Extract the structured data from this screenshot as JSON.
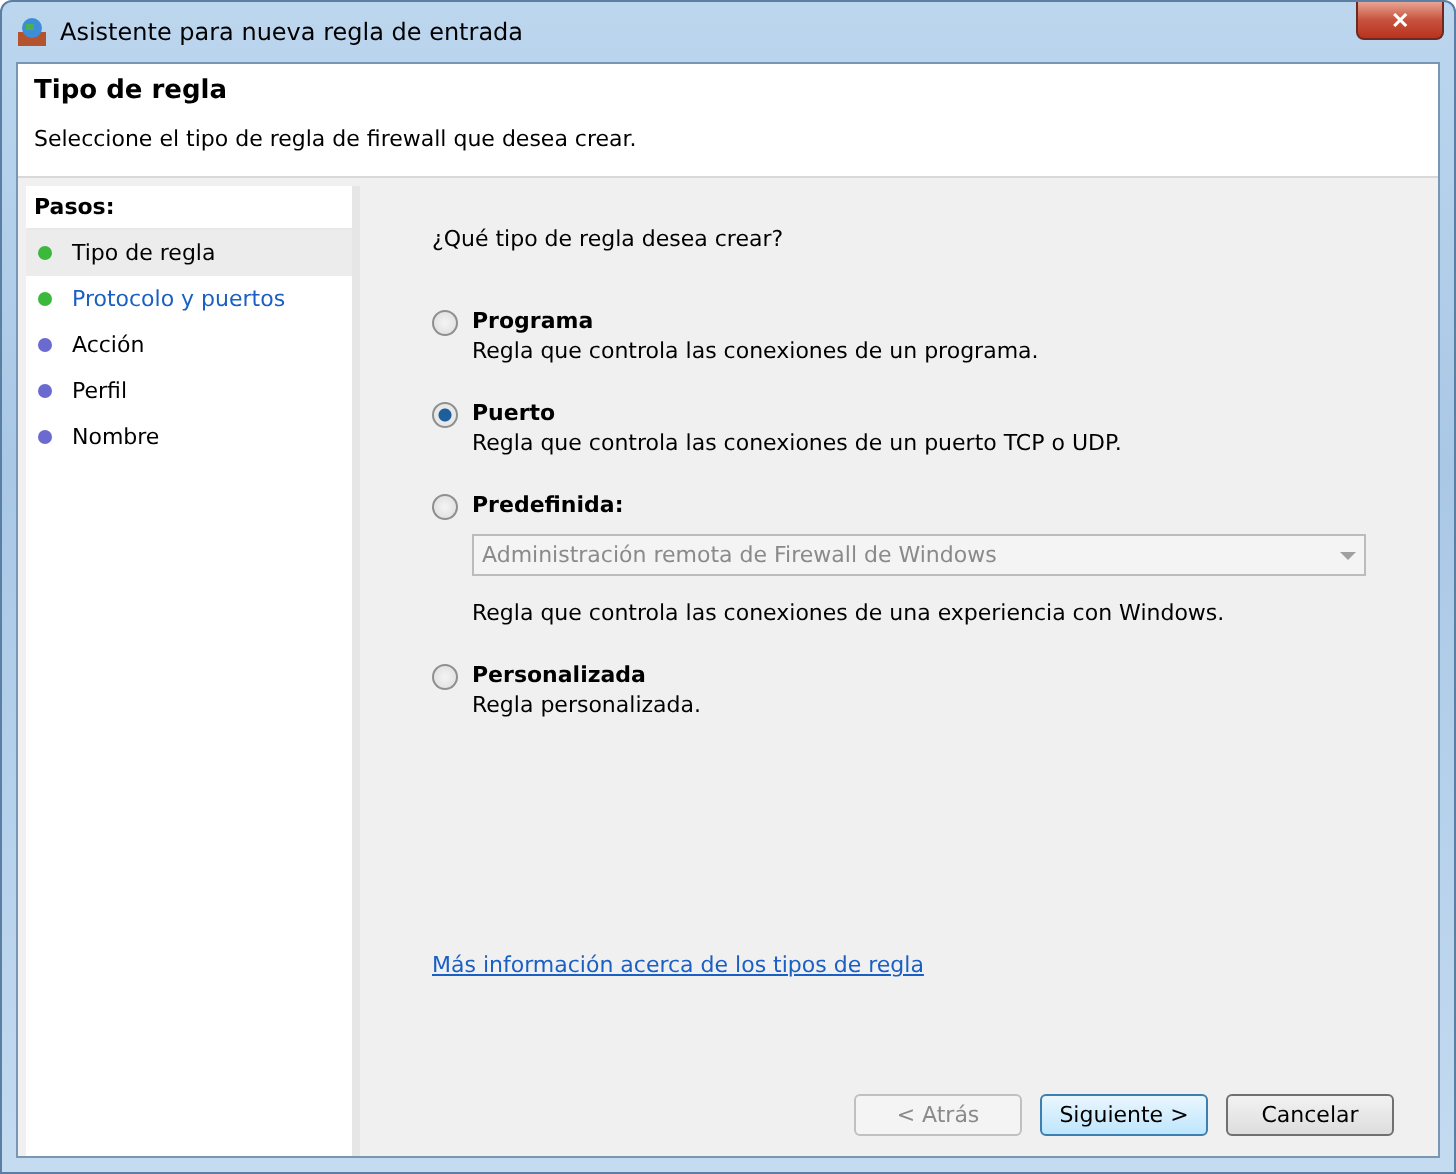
{
  "window": {
    "title": "Asistente para nueva regla de entrada",
    "close": "✕"
  },
  "header": {
    "title": "Tipo de regla",
    "subtitle": "Seleccione el tipo de regla de firewall que desea crear."
  },
  "steps": {
    "heading": "Pasos:",
    "items": [
      {
        "label": "Tipo de regla",
        "color": "#3cb83c",
        "selected": true,
        "highlighted": false
      },
      {
        "label": "Protocolo y puertos",
        "color": "#3cb83c",
        "selected": false,
        "highlighted": true
      },
      {
        "label": "Acción",
        "color": "#6a6ad0",
        "selected": false,
        "highlighted": false
      },
      {
        "label": "Perfil",
        "color": "#6a6ad0",
        "selected": false,
        "highlighted": false
      },
      {
        "label": "Nombre",
        "color": "#6a6ad0",
        "selected": false,
        "highlighted": false
      }
    ]
  },
  "question": "¿Qué tipo de regla desea crear?",
  "options": [
    {
      "label": "Programa",
      "description": "Regla que controla las conexiones de un programa.",
      "selected": false
    },
    {
      "label": "Puerto",
      "description": "Regla que controla las conexiones de un puerto TCP o UDP.",
      "selected": true
    },
    {
      "label": "Predefinida:",
      "dropdown": {
        "value": "Administración remota de Firewall de Windows",
        "disabled": true
      },
      "description": "Regla que controla las conexiones de una experiencia con Windows.",
      "selected": false
    },
    {
      "label": "Personalizada",
      "description": "Regla personalizada.",
      "selected": false
    }
  ],
  "link": "Más información acerca de los tipos de regla",
  "buttons": [
    {
      "label": "< Atrás",
      "disabled": true,
      "default": false
    },
    {
      "label": "Siguiente >",
      "disabled": false,
      "default": true
    },
    {
      "label": "Cancelar",
      "disabled": false,
      "default": false
    }
  ]
}
